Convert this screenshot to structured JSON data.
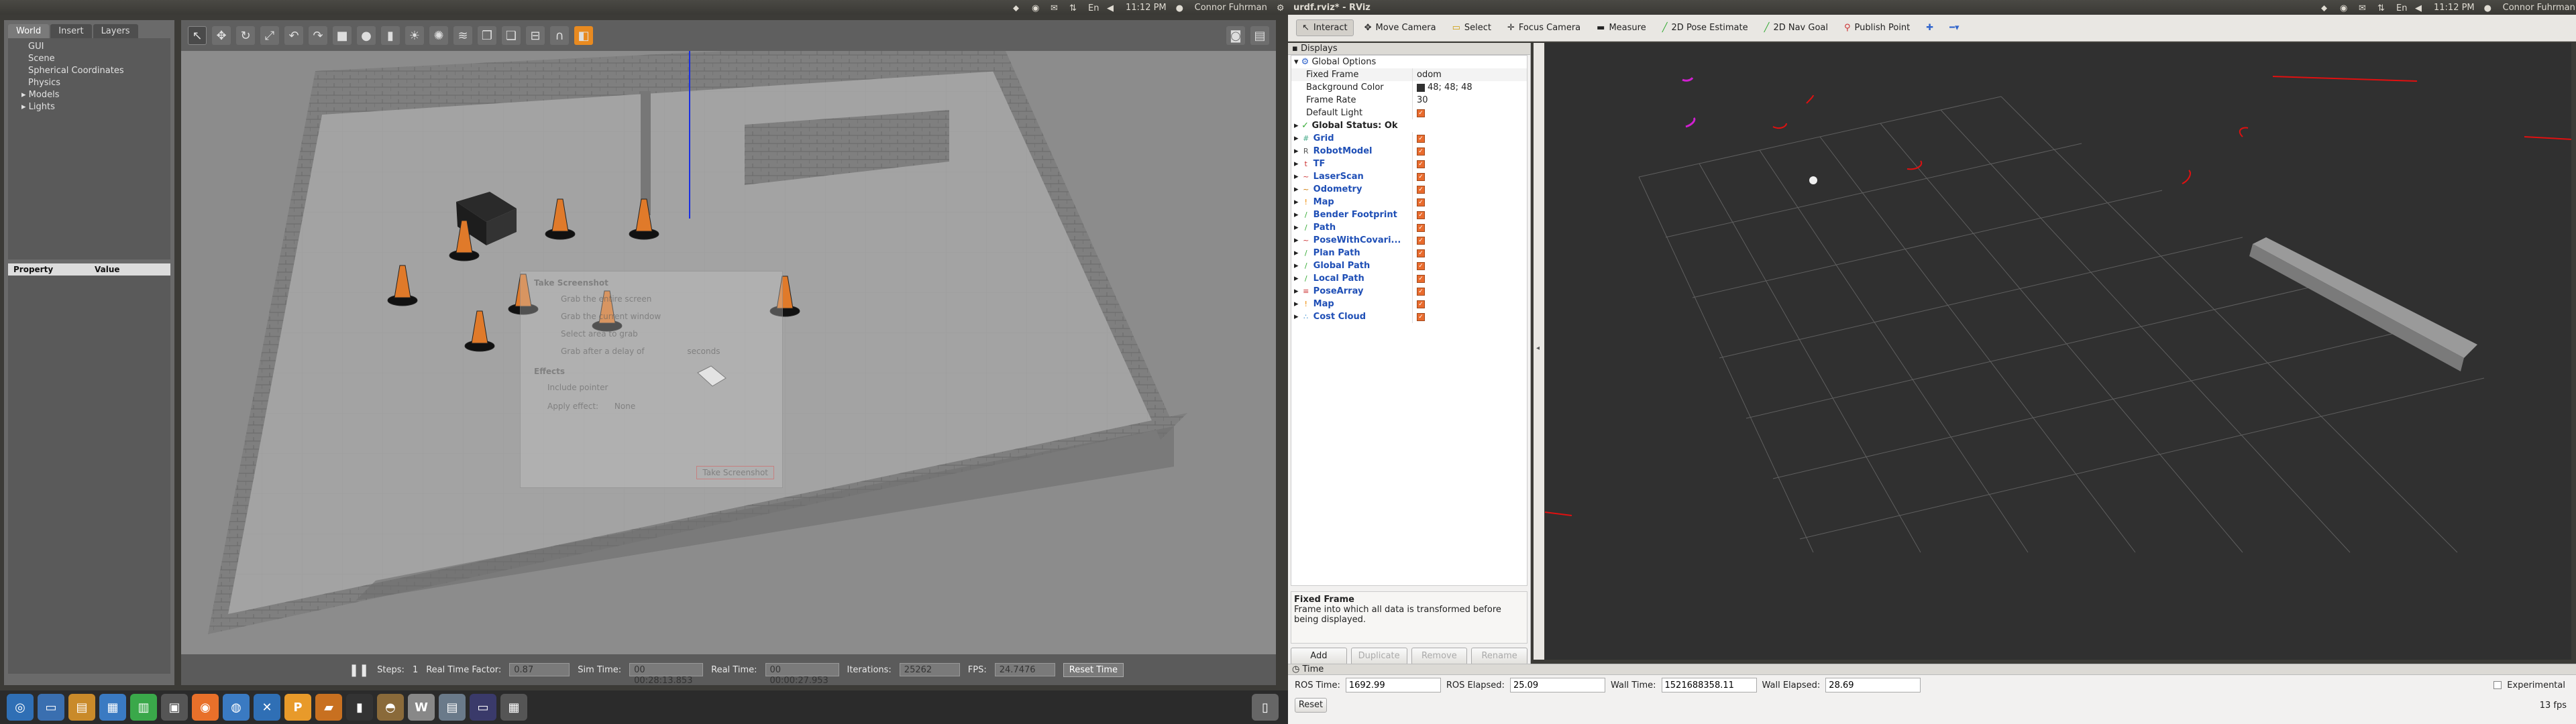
{
  "left_topbar": {
    "clock": "11:12 PM",
    "user": "Connor Fuhrman"
  },
  "rviz_topbar": {
    "title": "urdf.rviz* - RViz",
    "clock": "11:12 PM",
    "user": "Connor Fuhrman"
  },
  "gazebo": {
    "tabs": [
      "World",
      "Insert",
      "Layers"
    ],
    "tree": [
      "GUI",
      "Scene",
      "Spherical Coordinates",
      "Physics",
      "Models",
      "Lights"
    ],
    "prop_headers": [
      "Property",
      "Value"
    ],
    "bottom": {
      "steps_label": "Steps:",
      "steps_value": "1",
      "rtf_label": "Real Time Factor:",
      "rtf_value": "0.87",
      "sim_label": "Sim Time:",
      "sim_value": "00 00:28:13.853",
      "real_label": "Real Time:",
      "real_value": "00 00:00:27.953",
      "iter_label": "Iterations:",
      "iter_value": "25262",
      "fps_label": "FPS:",
      "fps_value": "24.7476",
      "reset": "Reset Time"
    },
    "overlay": {
      "title": "Take Screenshot",
      "line1": "Grab the entire screen",
      "line2": "Grab the current window",
      "line3": "Select area to grab",
      "line4": "Grab after a delay of",
      "effects": "Effects",
      "pointer": "Include pointer",
      "border": "Apply effect:",
      "none": "None",
      "btn": "Take Screenshot",
      "seconds": "seconds"
    }
  },
  "rviz": {
    "tools": [
      "Interact",
      "Move Camera",
      "Select",
      "Focus Camera",
      "Measure",
      "2D Pose Estimate",
      "2D Nav Goal",
      "Publish Point"
    ],
    "displays_title": "Displays",
    "global_options": "Global Options",
    "global_rows": [
      {
        "k": "Fixed Frame",
        "v": "odom"
      },
      {
        "k": "Background Color",
        "v": "48; 48; 48"
      },
      {
        "k": "Frame Rate",
        "v": "30"
      },
      {
        "k": "Default Light",
        "v": ""
      }
    ],
    "global_status": "Global Status: Ok",
    "displays": [
      {
        "name": "Grid",
        "icon": "#",
        "color": "#4a8"
      },
      {
        "name": "RobotModel",
        "icon": "R",
        "color": "#555"
      },
      {
        "name": "TF",
        "icon": "t",
        "color": "#c33"
      },
      {
        "name": "LaserScan",
        "icon": "~",
        "color": "#c33"
      },
      {
        "name": "Odometry",
        "icon": "~",
        "color": "#c70"
      },
      {
        "name": "Map",
        "icon": "!",
        "color": "#e80"
      },
      {
        "name": "Bender Footprint",
        "icon": "/",
        "color": "#3a3"
      },
      {
        "name": "Path",
        "icon": "/",
        "color": "#3a3"
      },
      {
        "name": "PoseWithCovari...",
        "icon": "~",
        "color": "#c33"
      },
      {
        "name": "Plan Path",
        "icon": "/",
        "color": "#3a3"
      },
      {
        "name": "Global Path",
        "icon": "/",
        "color": "#3a3"
      },
      {
        "name": "Local Path",
        "icon": "/",
        "color": "#3a3"
      },
      {
        "name": "PoseArray",
        "icon": "≡",
        "color": "#c33"
      },
      {
        "name": "Map",
        "icon": "!",
        "color": "#e80"
      },
      {
        "name": "Cost Cloud",
        "icon": "∴",
        "color": "#38c"
      }
    ],
    "desc_title": "Fixed Frame",
    "desc_text": "Frame into which all data is transformed before being displayed.",
    "buttons": [
      "Add",
      "Duplicate",
      "Remove",
      "Rename"
    ],
    "time_title": "Time",
    "ros_time_label": "ROS Time:",
    "ros_time": "1692.99",
    "ros_elapsed_label": "ROS Elapsed:",
    "ros_elapsed": "25.09",
    "wall_time_label": "Wall Time:",
    "wall_time": "1521688358.11",
    "wall_elapsed_label": "Wall Elapsed:",
    "wall_elapsed": "28.69",
    "experimental": "Experimental",
    "reset": "Reset",
    "fps": "13 fps"
  }
}
